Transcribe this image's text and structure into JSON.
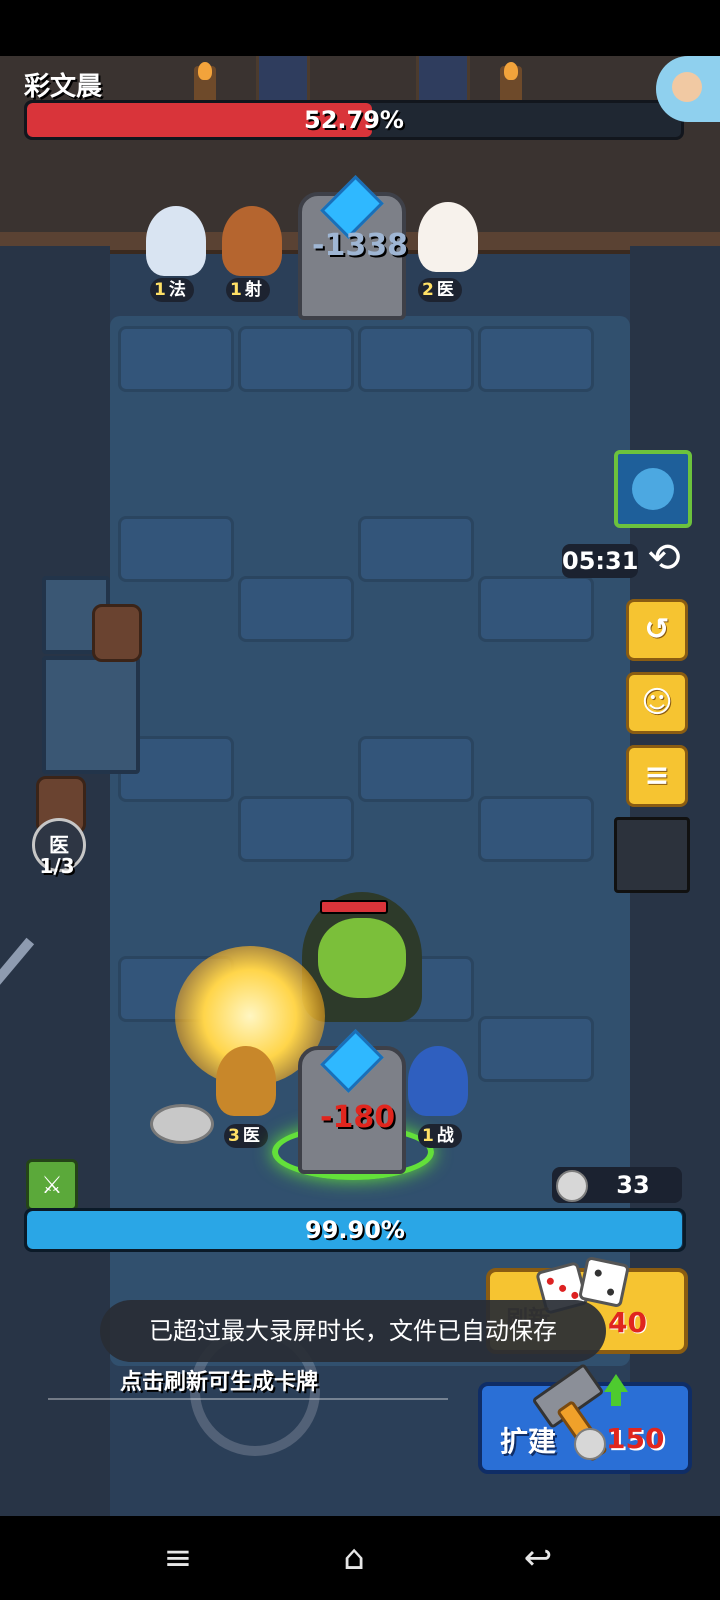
{
  "boss": {
    "name": "彩文晨",
    "hp_percent_text": "52.79%",
    "hp_fraction": 0.5279
  },
  "top_heroes": [
    {
      "level": "1",
      "class": "法"
    },
    {
      "level": "1",
      "class": "射"
    },
    {
      "level": "2",
      "class": "医"
    }
  ],
  "enemy_tower": {
    "damage_text": "-1338"
  },
  "timer": {
    "value": "05:31"
  },
  "side_buttons": {
    "undo_icon": "undo-icon",
    "emoji_icon": "smile-icon",
    "chat_icon": "chat-icon"
  },
  "medic_badge": {
    "label": "医",
    "count": "1/3"
  },
  "bottom_heroes": [
    {
      "level": "3",
      "class": "医"
    },
    {
      "level": "1",
      "class": "战"
    }
  ],
  "player_tower": {
    "damage_text": "-180"
  },
  "coins": {
    "value": "33"
  },
  "mana": {
    "percent_text": "99.90%",
    "fraction": 0.999
  },
  "refresh": {
    "label": "刷新",
    "cost": "40"
  },
  "build": {
    "label": "扩建",
    "cost": "150"
  },
  "toast": {
    "text": "已超过最大录屏时长，文件已自动保存"
  },
  "hint": {
    "text": "点击刷新可生成卡牌"
  },
  "navbar": {
    "menu_icon": "≡",
    "home_icon": "⌂",
    "back_icon": "↩"
  },
  "colors": {
    "boss_hp": "#d9343a",
    "mana": "#2aa6e6",
    "button_yellow": "#f6c431",
    "button_blue": "#2a6fd6"
  }
}
